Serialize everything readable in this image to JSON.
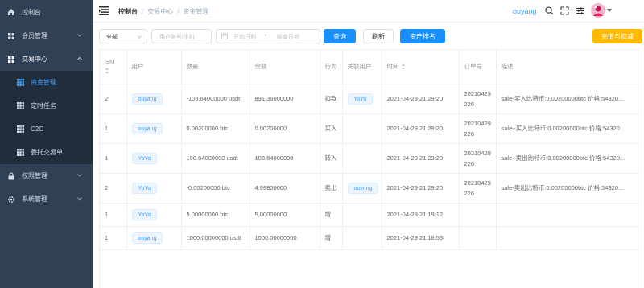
{
  "sidebar": {
    "items": [
      {
        "label": "控制台",
        "icon": "home-icon"
      },
      {
        "label": "会员管理",
        "icon": "grid-icon"
      },
      {
        "label": "交易中心",
        "icon": "grid-icon"
      },
      {
        "label": "资金管理",
        "icon": "table-icon"
      },
      {
        "label": "定时任务",
        "icon": "table-icon"
      },
      {
        "label": "C2C",
        "icon": "table-icon"
      },
      {
        "label": "委托交易单",
        "icon": "table-icon"
      },
      {
        "label": "权限管理",
        "icon": "lock-icon"
      },
      {
        "label": "系统管理",
        "icon": "gear-icon"
      }
    ]
  },
  "header": {
    "breadcrumb": [
      "控制台",
      "交易中心",
      "资金管理"
    ],
    "username": "ouyang"
  },
  "filters": {
    "type_select": "全部",
    "account_placeholder": "用户账号/手机",
    "start_date_placeholder": "开始日期",
    "date_separator": "-",
    "end_date_placeholder": "结束日期",
    "query_label": "查询",
    "refresh_label": "刷新",
    "rank_label": "资产排名",
    "recharge_label": "充值与扣减"
  },
  "table": {
    "columns": [
      "SN",
      "用户",
      "数量",
      "余额",
      "行为",
      "关联用户",
      "时间",
      "订单号",
      "描述"
    ],
    "rows": [
      {
        "sn": "2",
        "user": "ouyang",
        "amount": "-108.64000000 usdt",
        "balance": "891.36000000",
        "action": "扣款",
        "related": "YoYo",
        "time": "2021-04-29 21:29:20",
        "order_a": "20210429",
        "order_b": "226",
        "desc": "sale-买入比特币:0.00200000btc 价格:54320..."
      },
      {
        "sn": "1",
        "user": "ouyang",
        "amount": "0.00200000 btc",
        "balance": "0.00200000",
        "action": "买入",
        "related": "",
        "time": "2021-04-29 21:29:20",
        "order_a": "20210429",
        "order_b": "226",
        "desc": "sale+买入比特币:0.00200000btc 价格:54320..."
      },
      {
        "sn": "1",
        "user": "YoYo",
        "amount": "108.64000000 usdt",
        "balance": "108.64000000",
        "action": "转入",
        "related": "",
        "time": "2021-04-29 21:29:20",
        "order_a": "20210429",
        "order_b": "226",
        "desc": "sale+卖出比特币:0.00200000btc 价格:54320..."
      },
      {
        "sn": "2",
        "user": "YoYo",
        "amount": "-0.00200000 btc",
        "balance": "4.99800000",
        "action": "卖出",
        "related": "ouyang",
        "time": "2021-04-29 21:29:20",
        "order_a": "20210429",
        "order_b": "226",
        "desc": "sale-卖出比特币:0.00200000btc 价格:54320..."
      },
      {
        "sn": "1",
        "user": "YoYo",
        "amount": "5.00000000 btc",
        "balance": "5.00000000",
        "action": "增",
        "related": "",
        "time": "2021-04-29 21:19:12",
        "order_a": "",
        "order_b": "",
        "desc": ""
      },
      {
        "sn": "1",
        "user": "ouyang",
        "amount": "1000.00000000 usdt",
        "balance": "1000.00000000",
        "action": "增",
        "related": "",
        "time": "2021-04-29 21:18:53",
        "order_a": "",
        "order_b": "",
        "desc": ""
      }
    ]
  },
  "colors": {
    "sidebar_bg": "#304156",
    "accent": "#409eff",
    "primary_button": "#1890ff",
    "warning_button": "#ffba00"
  }
}
